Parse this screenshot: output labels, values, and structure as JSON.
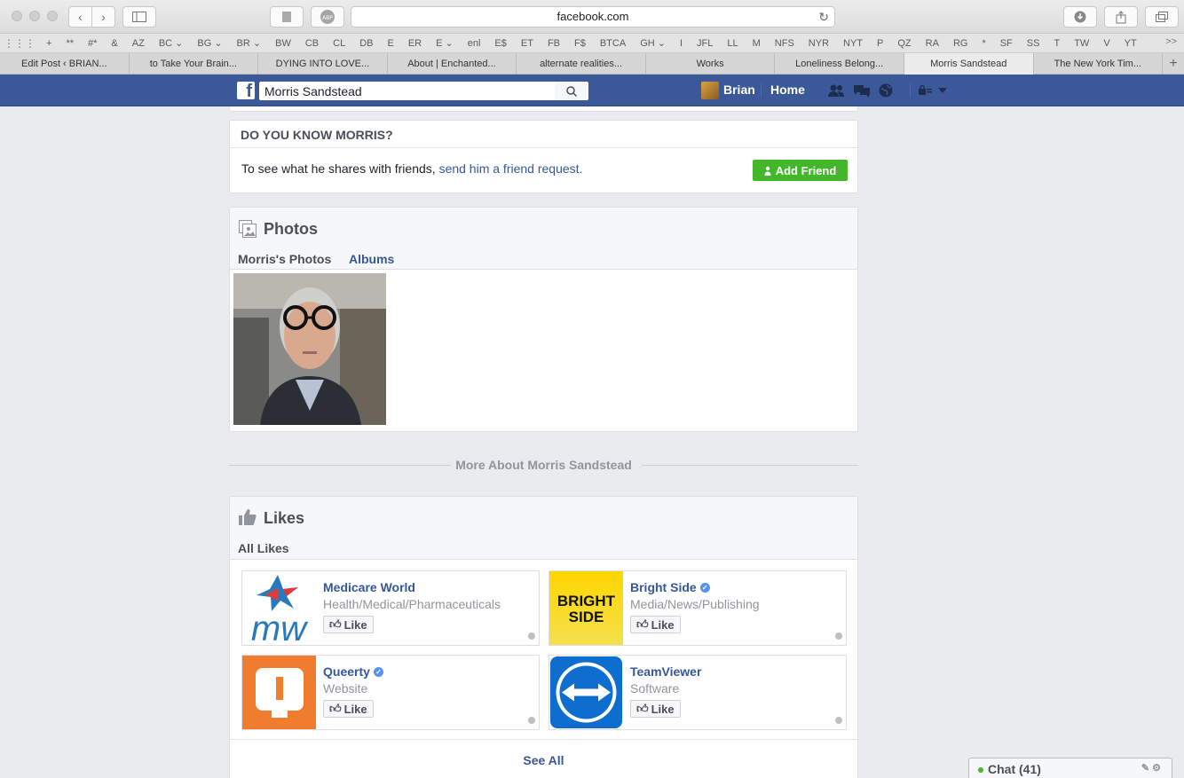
{
  "browser": {
    "url": "facebook.com",
    "favorites": [
      "+",
      "**",
      "#*",
      "&",
      "AZ",
      "BC ⌄",
      "BG ⌄",
      "BR ⌄",
      "BW",
      "CB",
      "CL",
      "DB",
      "E",
      "ER",
      "E ⌄",
      "enl",
      "E$",
      "ET",
      "FB",
      "F$",
      "BTCA",
      "GH ⌄",
      "I",
      "JFL",
      "LL",
      "M",
      "NFS",
      "NYR",
      "NYT",
      "P",
      "QZ",
      "RA",
      "RG",
      "*",
      "SF",
      "SS",
      "T",
      "TW",
      "V",
      "YT"
    ],
    "favorites_more": ">>",
    "tabs": [
      {
        "label": "Edit Post ‹ BRIAN..."
      },
      {
        "label": "to Take Your Brain..."
      },
      {
        "label": "DYING INTO LOVE..."
      },
      {
        "label": "About | Enchanted..."
      },
      {
        "label": "alternate realities..."
      },
      {
        "label": "Works"
      },
      {
        "label": "Loneliness Belong..."
      },
      {
        "label": "Morris Sandstead"
      },
      {
        "label": "The New York Tim..."
      }
    ],
    "active_tab_index": 7
  },
  "fb": {
    "search_value": "Morris Sandstead",
    "user_name": "Brian",
    "home_label": "Home"
  },
  "know": {
    "heading": "DO YOU KNOW MORRIS?",
    "text": "To see what he shares with friends, ",
    "link": "send him a friend request.",
    "add_friend": "Add Friend"
  },
  "photos": {
    "title": "Photos",
    "tab_active": "Morris's Photos",
    "tab_albums": "Albums"
  },
  "more_about": "More About Morris Sandstead",
  "likes": {
    "title": "Likes",
    "tab_active": "All Likes",
    "items": [
      {
        "name": "Medicare World",
        "category": "Health/Medical/Pharmaceuticals",
        "verified": false,
        "like": "Like"
      },
      {
        "name": "Bright Side",
        "category": "Media/News/Publishing",
        "verified": true,
        "like": "Like"
      },
      {
        "name": "Queerty",
        "category": "Website",
        "verified": true,
        "like": "Like"
      },
      {
        "name": "TeamViewer",
        "category": "Software",
        "verified": false,
        "like": "Like"
      }
    ],
    "bright_side_logo": [
      "BRIGHT",
      "SIDE"
    ],
    "medicare_logo": "mw",
    "see_all": "See All"
  },
  "chat": {
    "label": "Chat (41)"
  },
  "colors": {
    "fb_blue": "#3b5998",
    "link": "#365899",
    "add_friend": "#42b72a"
  }
}
